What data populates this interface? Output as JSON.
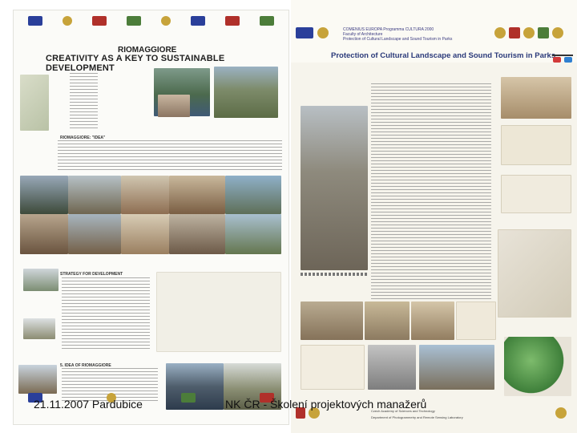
{
  "left_poster": {
    "title": "RIOMAGGIORE",
    "subtitle": "CREATIVITY AS A KEY TO SUSTAINABLE DEVELOPMENT",
    "sections": [
      "RIOMAGGIORE: \"IDEA\"",
      "STRATEGY FOR DEVELOPMENT",
      "5. IDEA OF RIOMAGGIORE"
    ]
  },
  "right_poster": {
    "header": [
      "COMENIUS EUROPA Programma CULTURA 2000",
      "Faculty of Architecture",
      "Protection of Cultural Landscape and Sound Tourism in Parks"
    ],
    "title": "Protection of Cultural Landscape and Sound Tourism in Parks",
    "footer": [
      "Czech Academy of Sciences and Technology",
      "Department of Photogrammetry and Remote Sensing Laboratory"
    ]
  },
  "footer": {
    "date": "21.11.2007 Pardubice",
    "training": "NK ČR - Školení projektových manažerů"
  },
  "colors": {
    "eu_flag": "#2a3f9a",
    "right_title": "#2b3a7a",
    "poster_bg": "#fbfbf8"
  }
}
